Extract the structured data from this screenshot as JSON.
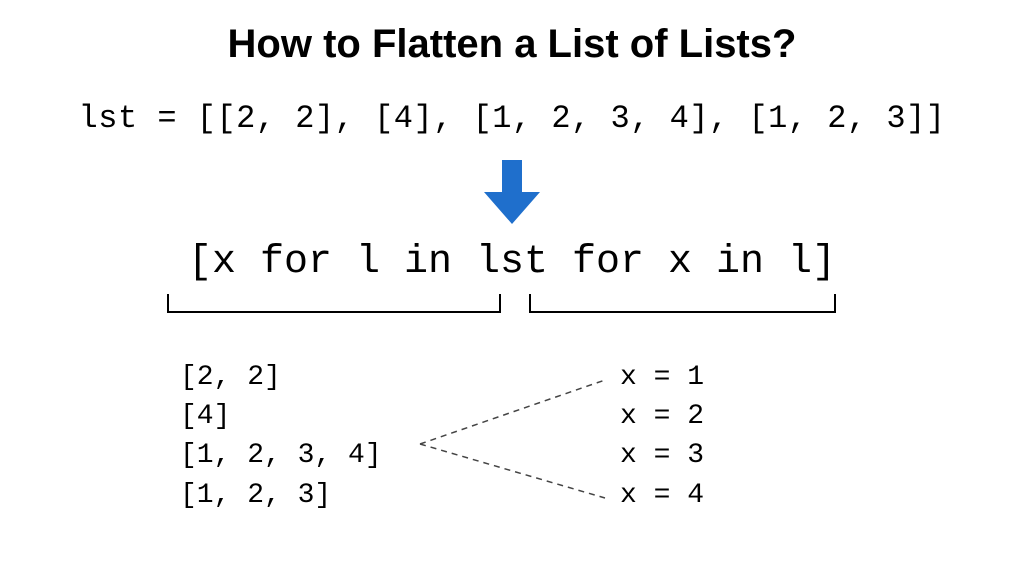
{
  "title": "How to Flatten a List of Lists?",
  "code_line": "lst = [[2, 2], [4], [1, 2, 3, 4], [1, 2, 3]]",
  "comprehension": {
    "full": "[x for l in lst for x in l]",
    "part1": "for l in lst",
    "part2": "for x in l"
  },
  "left_output": {
    "l1": "[2, 2]",
    "l2": "[4]",
    "l3": "[1, 2, 3, 4]",
    "l4": "[1, 2, 3]"
  },
  "right_output": {
    "r1": "x = 1",
    "r2": "x = 2",
    "r3": "x = 3",
    "r4": "x = 4"
  },
  "colors": {
    "arrow": "#1F6FCC"
  }
}
